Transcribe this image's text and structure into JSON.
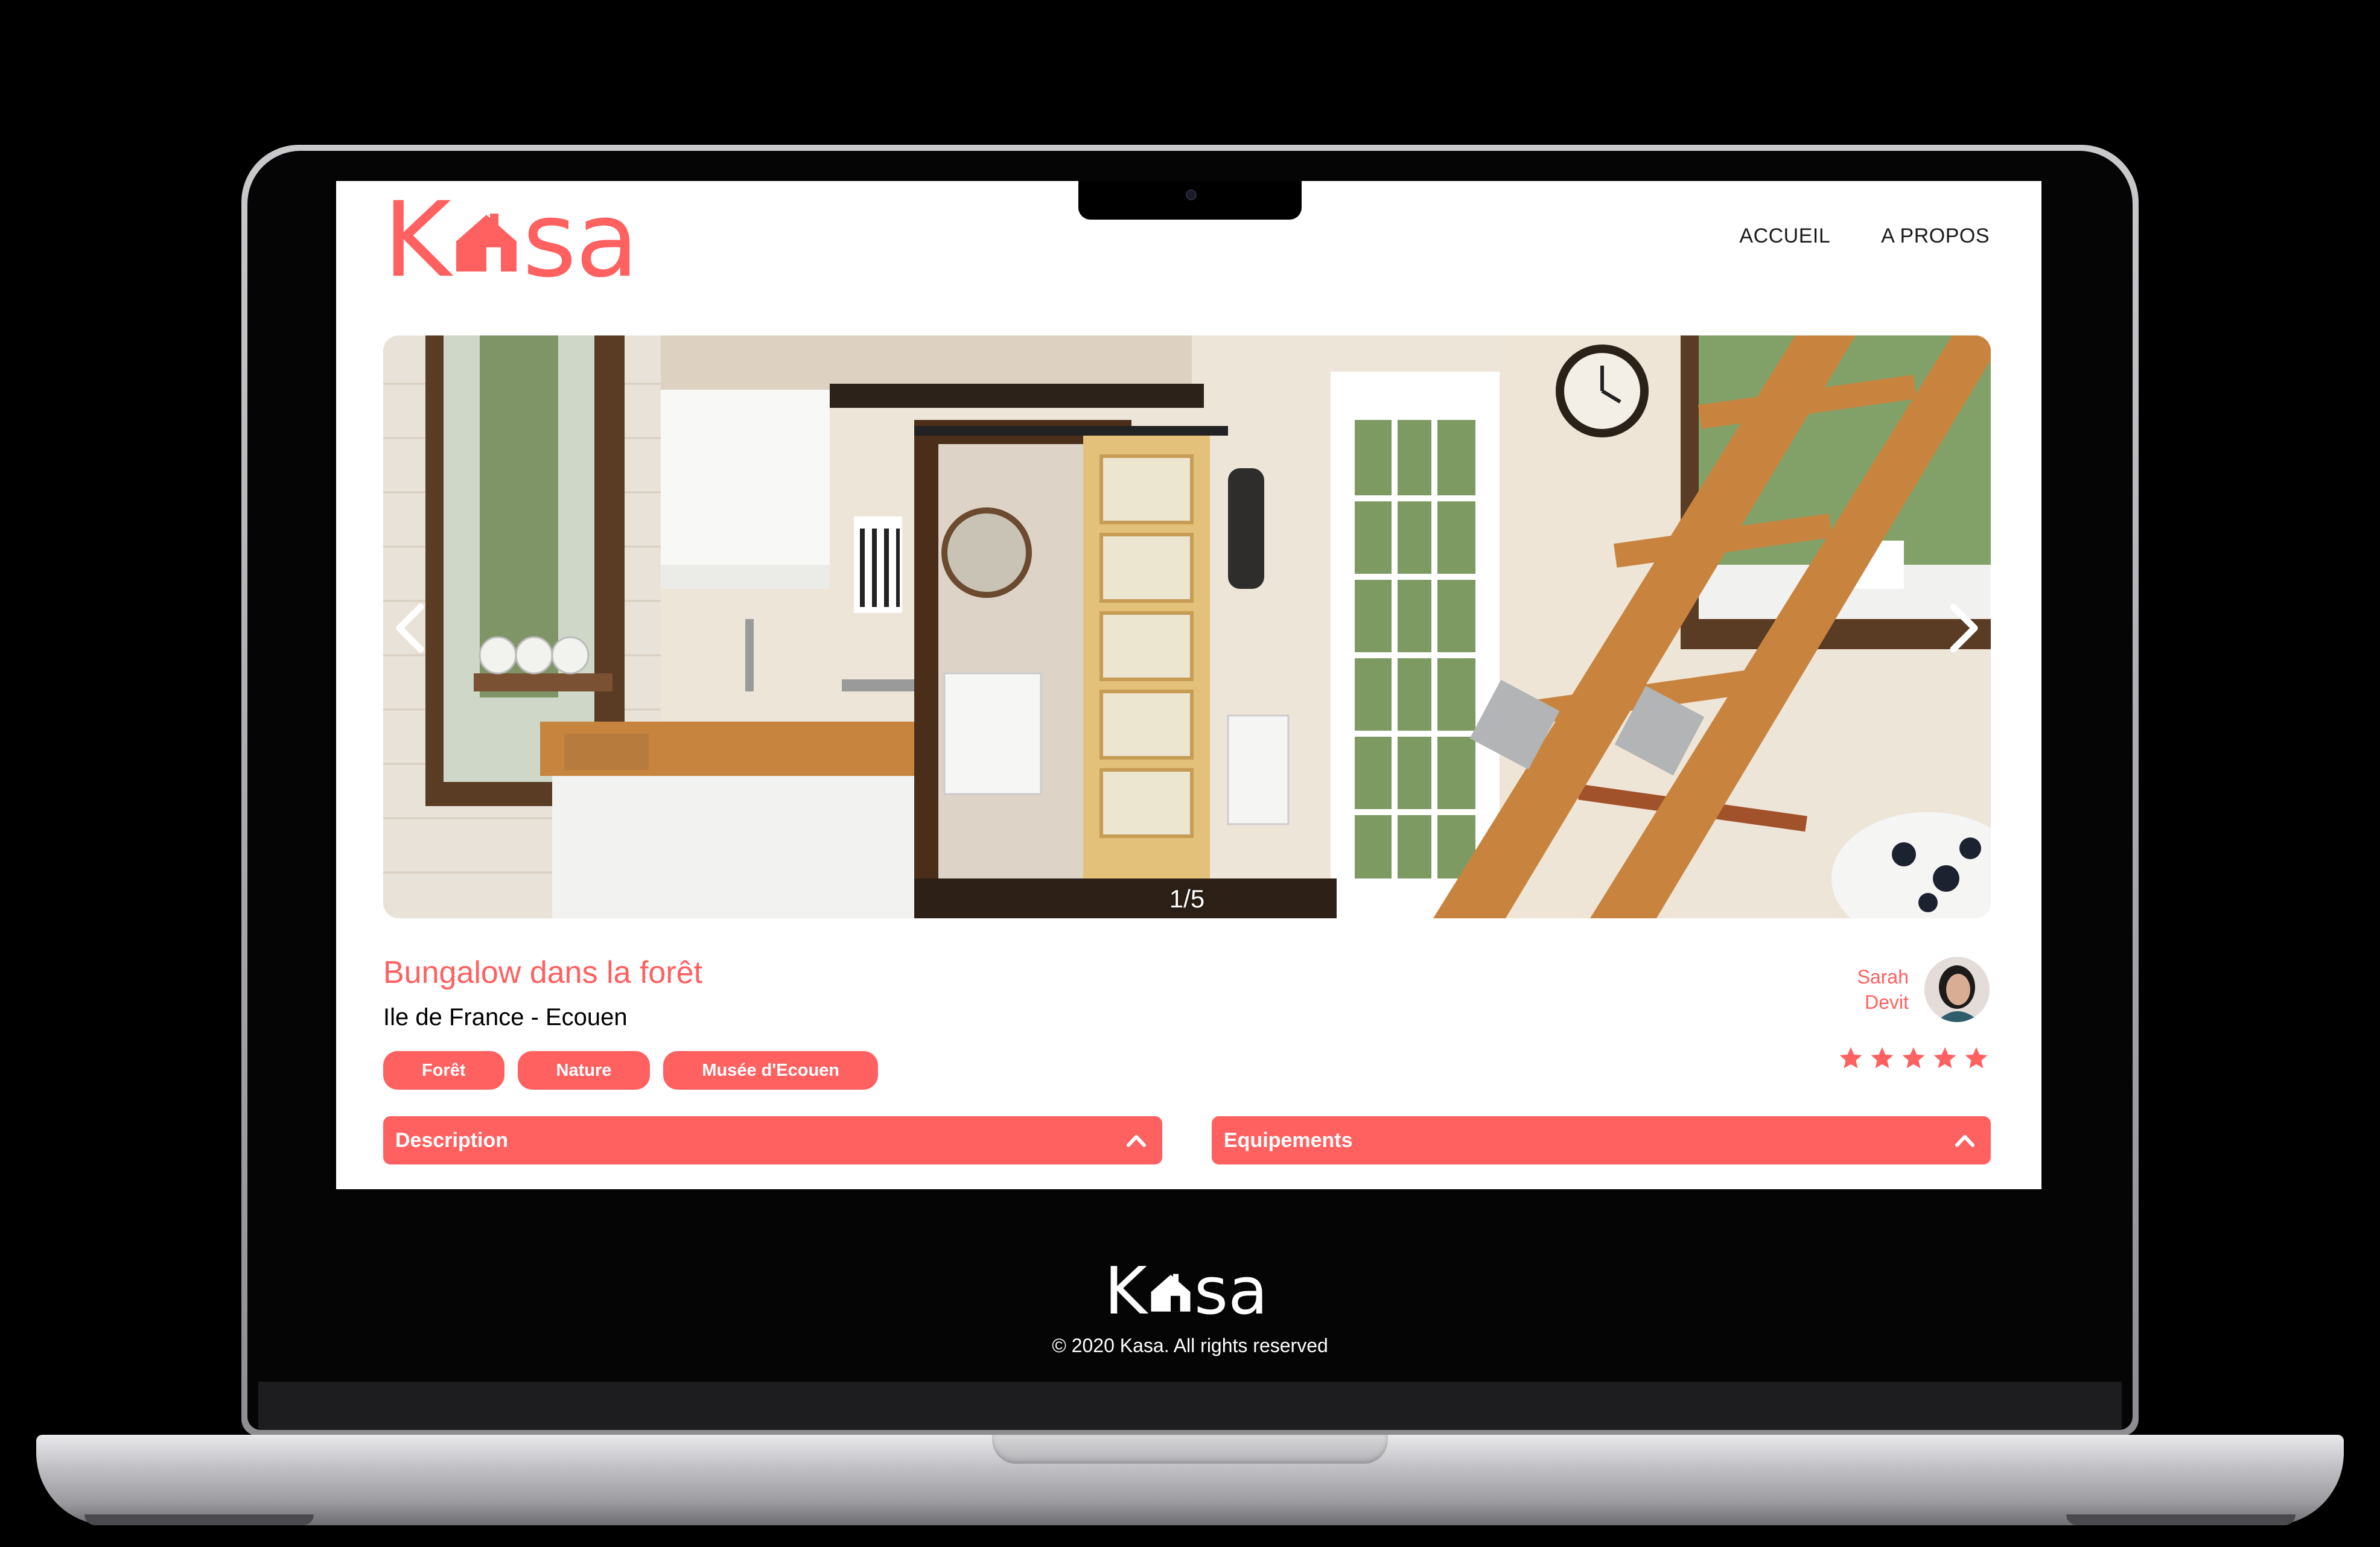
{
  "brand": {
    "logo_left": "K",
    "logo_right": "sa",
    "accent_color": "#FF6060"
  },
  "nav": {
    "home": "ACCUEIL",
    "about": "A PROPOS"
  },
  "gallery": {
    "counter": "1/5",
    "prev_icon": "chevron-left-icon",
    "next_icon": "chevron-right-icon"
  },
  "listing": {
    "title": "Bungalow dans la forêt",
    "location": "Ile de France - Ecouen",
    "tags": [
      "Forêt",
      "Nature",
      "Musée d'Ecouen"
    ],
    "host_first": "Sarah",
    "host_last": "Devit",
    "rating": 5,
    "rating_max": 5
  },
  "collapses": [
    {
      "label": "Description",
      "icon": "chevron-up-icon"
    },
    {
      "label": "Equipements",
      "icon": "chevron-up-icon"
    }
  ],
  "footer": {
    "logo_left": "K",
    "logo_right": "sa",
    "copyright": "© 2020 Kasa. All rights reserved"
  }
}
